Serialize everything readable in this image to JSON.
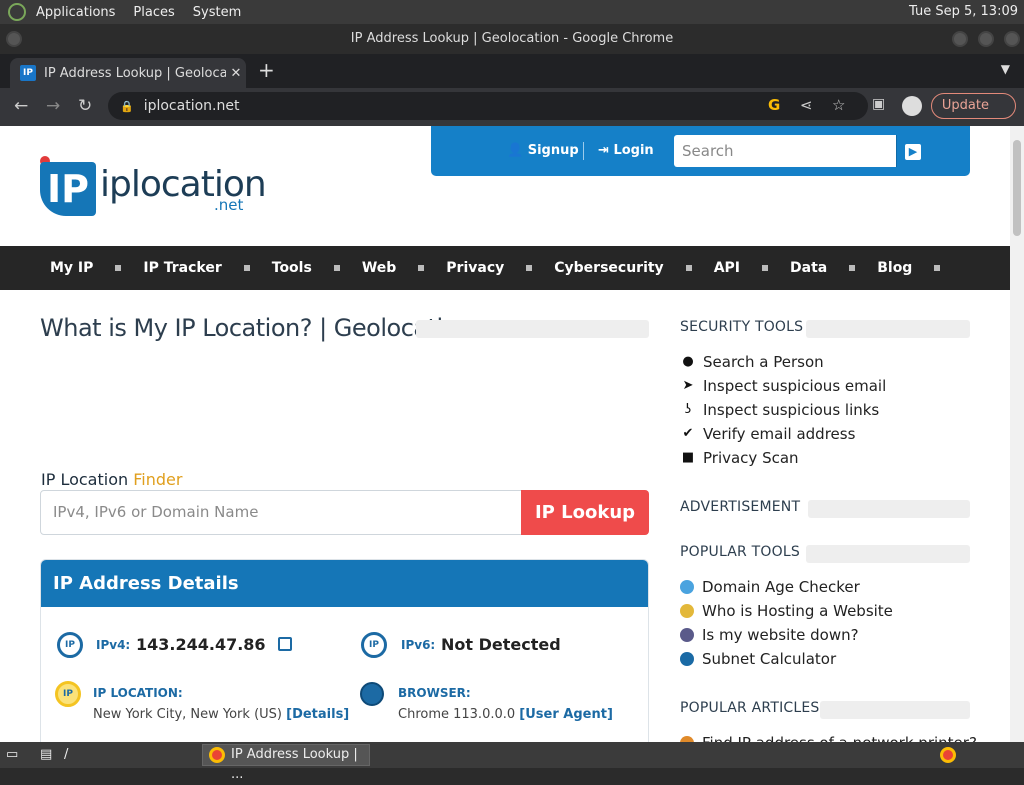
{
  "system": {
    "menu": [
      "Applications",
      "Places",
      "System"
    ],
    "clock": "Tue Sep  5, 13:09"
  },
  "window": {
    "title": "IP Address Lookup | Geolocation - Google Chrome"
  },
  "browser": {
    "tab_title": "IP Address Lookup | Geolocatio",
    "url": "iplocation.net",
    "update_label": "Update"
  },
  "site": {
    "logo_word": "iplocation",
    "logo_net": ".net",
    "logo_ip": "IP",
    "signup": "Signup",
    "login": "Login",
    "search_placeholder": "Search",
    "nav": [
      "My IP",
      "IP Tracker",
      "Tools",
      "Web",
      "Privacy",
      "Cybersecurity",
      "API",
      "Data",
      "Blog"
    ],
    "page_title": "What is My IP Location? | Geolocation",
    "finder_label": "IP Location ",
    "finder_accent": "Finder",
    "input_placeholder": "IPv4, IPv6 or Domain Name",
    "lookup_button": "IP Lookup",
    "details": {
      "title": "IP Address Details",
      "ipv4_label": "IPv4:",
      "ipv4_value": "143.244.47.86",
      "ipv6_label": "IPv6:",
      "ipv6_value": "Not Detected",
      "location_label": "IP LOCATION:",
      "location_value": "New York City, New York (US)",
      "location_link": "[Details]",
      "browser_label": "BROWSER:",
      "browser_value": "Chrome 113.0.0.0",
      "browser_link": "[User Agent]"
    },
    "sidebar": {
      "security_title": "SECURITY TOOLS",
      "security_items": [
        "Search a Person",
        "Inspect suspicious email",
        "Inspect suspicious links",
        "Verify email address",
        "Privacy Scan"
      ],
      "ad_title": "ADVERTISEMENT",
      "popular_title": "POPULAR TOOLS",
      "popular_items": [
        "Domain Age Checker",
        "Who is Hosting a Website",
        "Is my website down?",
        "Subnet Calculator"
      ],
      "articles_title": "POPULAR ARTICLES",
      "article_item": "Find IP address of a network printer?"
    }
  },
  "taskbar": {
    "path": "/",
    "task": "IP Address Lookup | ..."
  }
}
